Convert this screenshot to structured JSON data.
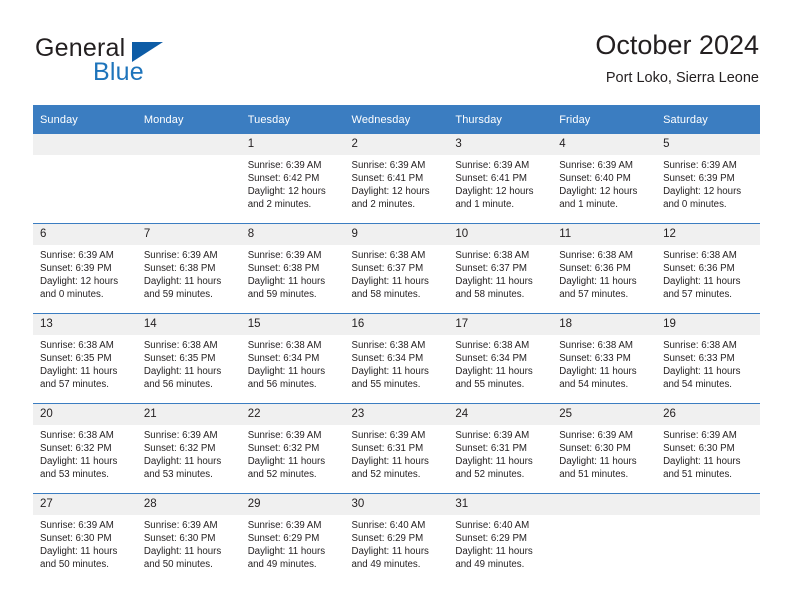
{
  "brand": {
    "word_one": "General",
    "word_two": "Blue",
    "triangle_color": "#0d5ca6",
    "blue_color": "#1e74bb"
  },
  "header": {
    "title": "October 2024",
    "subtitle": "Port Loko, Sierra Leone"
  },
  "theme": {
    "header_blue": "#3b7dc1",
    "daynum_gray": "#f0f0f0",
    "text": "#231f20"
  },
  "weekday_headers": [
    "Sunday",
    "Monday",
    "Tuesday",
    "Wednesday",
    "Thursday",
    "Friday",
    "Saturday"
  ],
  "weeks": [
    {
      "days": [
        {
          "date": "",
          "sunrise": "",
          "sunset": "",
          "daylight_line1": "",
          "daylight_line2": "",
          "empty": true
        },
        {
          "date": "",
          "sunrise": "",
          "sunset": "",
          "daylight_line1": "",
          "daylight_line2": "",
          "empty": true
        },
        {
          "date": "1",
          "sunrise": "Sunrise: 6:39 AM",
          "sunset": "Sunset: 6:42 PM",
          "daylight_line1": "Daylight: 12 hours",
          "daylight_line2": "and 2 minutes."
        },
        {
          "date": "2",
          "sunrise": "Sunrise: 6:39 AM",
          "sunset": "Sunset: 6:41 PM",
          "daylight_line1": "Daylight: 12 hours",
          "daylight_line2": "and 2 minutes."
        },
        {
          "date": "3",
          "sunrise": "Sunrise: 6:39 AM",
          "sunset": "Sunset: 6:41 PM",
          "daylight_line1": "Daylight: 12 hours",
          "daylight_line2": "and 1 minute."
        },
        {
          "date": "4",
          "sunrise": "Sunrise: 6:39 AM",
          "sunset": "Sunset: 6:40 PM",
          "daylight_line1": "Daylight: 12 hours",
          "daylight_line2": "and 1 minute."
        },
        {
          "date": "5",
          "sunrise": "Sunrise: 6:39 AM",
          "sunset": "Sunset: 6:39 PM",
          "daylight_line1": "Daylight: 12 hours",
          "daylight_line2": "and 0 minutes."
        }
      ]
    },
    {
      "days": [
        {
          "date": "6",
          "sunrise": "Sunrise: 6:39 AM",
          "sunset": "Sunset: 6:39 PM",
          "daylight_line1": "Daylight: 12 hours",
          "daylight_line2": "and 0 minutes."
        },
        {
          "date": "7",
          "sunrise": "Sunrise: 6:39 AM",
          "sunset": "Sunset: 6:38 PM",
          "daylight_line1": "Daylight: 11 hours",
          "daylight_line2": "and 59 minutes."
        },
        {
          "date": "8",
          "sunrise": "Sunrise: 6:39 AM",
          "sunset": "Sunset: 6:38 PM",
          "daylight_line1": "Daylight: 11 hours",
          "daylight_line2": "and 59 minutes."
        },
        {
          "date": "9",
          "sunrise": "Sunrise: 6:38 AM",
          "sunset": "Sunset: 6:37 PM",
          "daylight_line1": "Daylight: 11 hours",
          "daylight_line2": "and 58 minutes."
        },
        {
          "date": "10",
          "sunrise": "Sunrise: 6:38 AM",
          "sunset": "Sunset: 6:37 PM",
          "daylight_line1": "Daylight: 11 hours",
          "daylight_line2": "and 58 minutes."
        },
        {
          "date": "11",
          "sunrise": "Sunrise: 6:38 AM",
          "sunset": "Sunset: 6:36 PM",
          "daylight_line1": "Daylight: 11 hours",
          "daylight_line2": "and 57 minutes."
        },
        {
          "date": "12",
          "sunrise": "Sunrise: 6:38 AM",
          "sunset": "Sunset: 6:36 PM",
          "daylight_line1": "Daylight: 11 hours",
          "daylight_line2": "and 57 minutes."
        }
      ]
    },
    {
      "days": [
        {
          "date": "13",
          "sunrise": "Sunrise: 6:38 AM",
          "sunset": "Sunset: 6:35 PM",
          "daylight_line1": "Daylight: 11 hours",
          "daylight_line2": "and 57 minutes."
        },
        {
          "date": "14",
          "sunrise": "Sunrise: 6:38 AM",
          "sunset": "Sunset: 6:35 PM",
          "daylight_line1": "Daylight: 11 hours",
          "daylight_line2": "and 56 minutes."
        },
        {
          "date": "15",
          "sunrise": "Sunrise: 6:38 AM",
          "sunset": "Sunset: 6:34 PM",
          "daylight_line1": "Daylight: 11 hours",
          "daylight_line2": "and 56 minutes."
        },
        {
          "date": "16",
          "sunrise": "Sunrise: 6:38 AM",
          "sunset": "Sunset: 6:34 PM",
          "daylight_line1": "Daylight: 11 hours",
          "daylight_line2": "and 55 minutes."
        },
        {
          "date": "17",
          "sunrise": "Sunrise: 6:38 AM",
          "sunset": "Sunset: 6:34 PM",
          "daylight_line1": "Daylight: 11 hours",
          "daylight_line2": "and 55 minutes."
        },
        {
          "date": "18",
          "sunrise": "Sunrise: 6:38 AM",
          "sunset": "Sunset: 6:33 PM",
          "daylight_line1": "Daylight: 11 hours",
          "daylight_line2": "and 54 minutes."
        },
        {
          "date": "19",
          "sunrise": "Sunrise: 6:38 AM",
          "sunset": "Sunset: 6:33 PM",
          "daylight_line1": "Daylight: 11 hours",
          "daylight_line2": "and 54 minutes."
        }
      ]
    },
    {
      "days": [
        {
          "date": "20",
          "sunrise": "Sunrise: 6:38 AM",
          "sunset": "Sunset: 6:32 PM",
          "daylight_line1": "Daylight: 11 hours",
          "daylight_line2": "and 53 minutes."
        },
        {
          "date": "21",
          "sunrise": "Sunrise: 6:39 AM",
          "sunset": "Sunset: 6:32 PM",
          "daylight_line1": "Daylight: 11 hours",
          "daylight_line2": "and 53 minutes."
        },
        {
          "date": "22",
          "sunrise": "Sunrise: 6:39 AM",
          "sunset": "Sunset: 6:32 PM",
          "daylight_line1": "Daylight: 11 hours",
          "daylight_line2": "and 52 minutes."
        },
        {
          "date": "23",
          "sunrise": "Sunrise: 6:39 AM",
          "sunset": "Sunset: 6:31 PM",
          "daylight_line1": "Daylight: 11 hours",
          "daylight_line2": "and 52 minutes."
        },
        {
          "date": "24",
          "sunrise": "Sunrise: 6:39 AM",
          "sunset": "Sunset: 6:31 PM",
          "daylight_line1": "Daylight: 11 hours",
          "daylight_line2": "and 52 minutes."
        },
        {
          "date": "25",
          "sunrise": "Sunrise: 6:39 AM",
          "sunset": "Sunset: 6:30 PM",
          "daylight_line1": "Daylight: 11 hours",
          "daylight_line2": "and 51 minutes."
        },
        {
          "date": "26",
          "sunrise": "Sunrise: 6:39 AM",
          "sunset": "Sunset: 6:30 PM",
          "daylight_line1": "Daylight: 11 hours",
          "daylight_line2": "and 51 minutes."
        }
      ]
    },
    {
      "days": [
        {
          "date": "27",
          "sunrise": "Sunrise: 6:39 AM",
          "sunset": "Sunset: 6:30 PM",
          "daylight_line1": "Daylight: 11 hours",
          "daylight_line2": "and 50 minutes."
        },
        {
          "date": "28",
          "sunrise": "Sunrise: 6:39 AM",
          "sunset": "Sunset: 6:30 PM",
          "daylight_line1": "Daylight: 11 hours",
          "daylight_line2": "and 50 minutes."
        },
        {
          "date": "29",
          "sunrise": "Sunrise: 6:39 AM",
          "sunset": "Sunset: 6:29 PM",
          "daylight_line1": "Daylight: 11 hours",
          "daylight_line2": "and 49 minutes."
        },
        {
          "date": "30",
          "sunrise": "Sunrise: 6:40 AM",
          "sunset": "Sunset: 6:29 PM",
          "daylight_line1": "Daylight: 11 hours",
          "daylight_line2": "and 49 minutes."
        },
        {
          "date": "31",
          "sunrise": "Sunrise: 6:40 AM",
          "sunset": "Sunset: 6:29 PM",
          "daylight_line1": "Daylight: 11 hours",
          "daylight_line2": "and 49 minutes."
        },
        {
          "date": "",
          "sunrise": "",
          "sunset": "",
          "daylight_line1": "",
          "daylight_line2": "",
          "empty": true
        },
        {
          "date": "",
          "sunrise": "",
          "sunset": "",
          "daylight_line1": "",
          "daylight_line2": "",
          "empty": true
        }
      ]
    }
  ]
}
